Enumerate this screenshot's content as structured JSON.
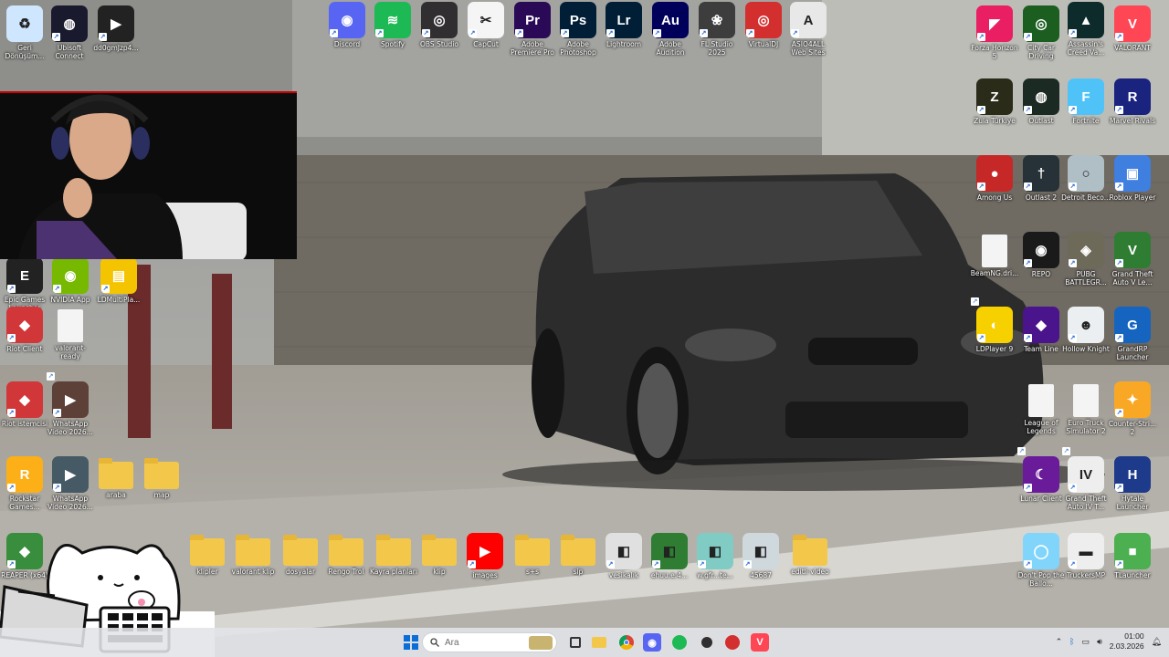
{
  "desktop": {
    "icons": [
      {
        "label": "Geri Dönüşüm...",
        "icon": "recycle-bin-icon",
        "color": "#cfe6ff"
      },
      {
        "label": "Ubisoft Connect",
        "icon": "ubisoft-icon",
        "color": "#1a1a2e"
      },
      {
        "label": "dd0gmJzp4...",
        "icon": "video-file-icon",
        "color": "#222"
      },
      {
        "label": "Discord",
        "icon": "discord-icon",
        "color": "#5865f2"
      },
      {
        "label": "Spotify",
        "icon": "spotify-icon",
        "color": "#1db954"
      },
      {
        "label": "OBS Studio",
        "icon": "obs-icon",
        "color": "#302e31"
      },
      {
        "label": "CapCut",
        "icon": "capcut-icon",
        "color": "#f5f5f5"
      },
      {
        "label": "Adobe Premiere Pro",
        "icon": "premiere-icon",
        "color": "#2a0a56"
      },
      {
        "label": "Adobe Photoshop",
        "icon": "photoshop-icon",
        "color": "#001e36"
      },
      {
        "label": "Lightroom",
        "icon": "lightroom-icon",
        "color": "#001e36"
      },
      {
        "label": "Adobe Audition",
        "icon": "audition-icon",
        "color": "#00005b"
      },
      {
        "label": "FL Studio 2025",
        "icon": "fl-studio-icon",
        "color": "#3d3d3d"
      },
      {
        "label": "VirtualDJ",
        "icon": "virtualdj-icon",
        "color": "#d32f2f"
      },
      {
        "label": "ASIO4ALL Web Sites",
        "icon": "asio4all-icon",
        "color": "#e8e8e8"
      },
      {
        "label": "Forza Horizon 5",
        "icon": "forza-icon",
        "color": "#e91e63"
      },
      {
        "label": "City Car Driving",
        "icon": "city-car-icon",
        "color": "#1b5e20"
      },
      {
        "label": "Assassin's Creed Va...",
        "icon": "assassins-creed-icon",
        "color": "#0d2b2b"
      },
      {
        "label": "VALORANT",
        "icon": "valorant-icon",
        "color": "#ff4655"
      },
      {
        "label": "Zula Türkiye",
        "icon": "zula-icon",
        "color": "#2b2b1a"
      },
      {
        "label": "Outlast",
        "icon": "outlast-icon",
        "color": "#1b2a22"
      },
      {
        "label": "Fortnite",
        "icon": "fortnite-icon",
        "color": "#4fc3f7"
      },
      {
        "label": "Marvel Rivals",
        "icon": "marvel-rivals-icon",
        "color": "#1a237e"
      },
      {
        "label": "Among Us",
        "icon": "among-us-icon",
        "color": "#c62828"
      },
      {
        "label": "Outlast 2",
        "icon": "outlast-2-icon",
        "color": "#263238"
      },
      {
        "label": "Detroit Beco...",
        "icon": "detroit-icon",
        "color": "#b0bec5"
      },
      {
        "label": "Roblox Player",
        "icon": "roblox-icon",
        "color": "#3f7fe0"
      },
      {
        "label": "BeamNG.dri...",
        "icon": "file-icon",
        "color": "#f2f2f2"
      },
      {
        "label": "REPO",
        "icon": "repo-icon",
        "color": "#1a1a1a"
      },
      {
        "label": "PUBG BATTLEGR...",
        "icon": "pubg-icon",
        "color": "#6d6a5a"
      },
      {
        "label": "Grand Theft Auto V Le...",
        "icon": "gta-v-icon",
        "color": "#2e7d32"
      },
      {
        "label": "Epic Games Launcher",
        "icon": "epic-games-icon",
        "color": "#222"
      },
      {
        "label": "NVIDIA App",
        "icon": "nvidia-icon",
        "color": "#76b900"
      },
      {
        "label": "LDMultiPla...",
        "icon": "ldmultiplayer-icon",
        "color": "#f5c400"
      },
      {
        "label": "Riot Client",
        "icon": "riot-client-icon",
        "color": "#d13639"
      },
      {
        "label": "valorant-ready",
        "icon": "file-icon",
        "color": "#f2f2f2"
      },
      {
        "label": "LDPlayer 9",
        "icon": "ldplayer-icon",
        "color": "#f7d000"
      },
      {
        "label": "Team Line",
        "icon": "team-line-icon",
        "color": "#4a148c"
      },
      {
        "label": "Hollow Knight",
        "icon": "hollow-knight-icon",
        "color": "#eceff1"
      },
      {
        "label": "GrandRP Launcher",
        "icon": "grandrp-icon",
        "color": "#1565c0"
      },
      {
        "label": "Riot istemcisi",
        "icon": "riot-client-icon",
        "color": "#d13639"
      },
      {
        "label": "WhatsApp Video 2026...",
        "icon": "video-thumb-icon",
        "color": "#5d4037"
      },
      {
        "label": "League of Legends",
        "icon": "file-icon",
        "color": "#f2f2f2"
      },
      {
        "label": "Euro Truck Simulator 2",
        "icon": "file-icon",
        "color": "#f2f2f2"
      },
      {
        "label": "Counter-Stri... 2",
        "icon": "counter-strike-icon",
        "color": "#f9a825"
      },
      {
        "label": "Rockstar Games...",
        "icon": "rockstar-icon",
        "color": "#fcaf17"
      },
      {
        "label": "WhatsApp Video 2026...",
        "icon": "video-thumb-icon",
        "color": "#455a64"
      },
      {
        "label": "araba",
        "icon": "folder-icon",
        "color": "#f3c84a"
      },
      {
        "label": "map",
        "icon": "folder-icon",
        "color": "#f3c84a"
      },
      {
        "label": "Lunar Client",
        "icon": "lunar-client-icon",
        "color": "#6a1b9a"
      },
      {
        "label": "Grand Theft Auto IV T...",
        "icon": "gta-iv-icon",
        "color": "#eeeeee"
      },
      {
        "label": "Hytale Launcher",
        "icon": "hytale-icon",
        "color": "#1e3a8a"
      },
      {
        "label": "REAPER (x64)",
        "icon": "reaper-icon",
        "color": "#388e3c"
      },
      {
        "label": "klipler",
        "icon": "folder-icon",
        "color": "#f3c84a"
      },
      {
        "label": "valorant klip",
        "icon": "folder-icon",
        "color": "#f3c84a"
      },
      {
        "label": "dosyalar",
        "icon": "folder-icon",
        "color": "#f3c84a"
      },
      {
        "label": "Rengo Trol",
        "icon": "folder-icon",
        "color": "#f3c84a"
      },
      {
        "label": "Kayra planları",
        "icon": "folder-icon",
        "color": "#f3c84a"
      },
      {
        "label": "klip",
        "icon": "folder-icon",
        "color": "#f3c84a"
      },
      {
        "label": "images",
        "icon": "youtube-icon",
        "color": "#ff0000"
      },
      {
        "label": "s+s",
        "icon": "folder-icon",
        "color": "#f3c84a"
      },
      {
        "label": "sip",
        "icon": "folder-icon",
        "color": "#f3c84a"
      },
      {
        "label": "vesikalık",
        "icon": "photo-icon",
        "color": "#e0e0e0"
      },
      {
        "label": "ehuu.e.4...",
        "icon": "photo-icon",
        "color": "#2e7d32"
      },
      {
        "label": "w.gfr...te...",
        "icon": "photo-icon",
        "color": "#80cbc4"
      },
      {
        "label": "45687",
        "icon": "photo-icon",
        "color": "#cfd8dc"
      },
      {
        "label": "editli video",
        "icon": "folder-icon",
        "color": "#f3c84a"
      },
      {
        "label": "Don't Pop the Ballo...",
        "icon": "balloon-game-icon",
        "color": "#81d4fa"
      },
      {
        "label": "TruckersMP",
        "icon": "truckersmp-icon",
        "color": "#eeeeee"
      },
      {
        "label": "TLauncher",
        "icon": "tlauncher-icon",
        "color": "#4caf50"
      }
    ],
    "glyphs": {
      "Pr": "Pr",
      "Ps": "Ps",
      "Lr": "Lr",
      "Au": "Au"
    }
  },
  "taskbar": {
    "search_placeholder": "Ara",
    "apps": [
      {
        "name": "start-button"
      },
      {
        "name": "task-view-icon"
      },
      {
        "name": "file-explorer-icon"
      },
      {
        "name": "chrome-icon"
      },
      {
        "name": "discord-taskbar-icon"
      },
      {
        "name": "spotify-taskbar-icon"
      },
      {
        "name": "obs-taskbar-icon"
      },
      {
        "name": "recorder-taskbar-icon"
      },
      {
        "name": "valorant-taskbar-icon"
      }
    ],
    "time": "01:00",
    "date": "2.03.2026"
  }
}
